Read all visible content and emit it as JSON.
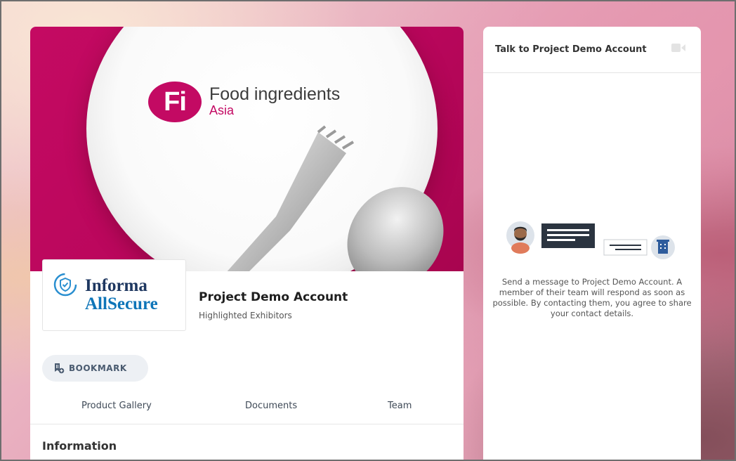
{
  "banner": {
    "logo_mark": "Fi",
    "logo_line1": "Food ingredients",
    "logo_line2": "Asia"
  },
  "exhibitor": {
    "logo_word1": "Informa",
    "logo_word2": "AllSecure",
    "name": "Project Demo Account",
    "category": "Highlighted Exhibitors"
  },
  "actions": {
    "bookmark_label": "BOOKMARK"
  },
  "tabs": [
    {
      "label": "Product Gallery"
    },
    {
      "label": "Documents"
    },
    {
      "label": "Team"
    }
  ],
  "section": {
    "title": "Information"
  },
  "chat": {
    "title": "Talk to Project Demo Account",
    "message": "Send a message to Project Demo Account. A member of their team will respond as soon as possible. By contacting them, you agree to share your contact details."
  },
  "icons": {
    "bookmark": "bookmark-add-icon",
    "video": "video-camera-icon",
    "shield": "shield-check-icon",
    "building": "building-icon",
    "avatar": "person-avatar-icon"
  },
  "colors": {
    "brand_magenta": "#c30a63",
    "informa_navy": "#1e3760",
    "informa_blue": "#0e75b8",
    "tab_text": "#3f4a57"
  }
}
